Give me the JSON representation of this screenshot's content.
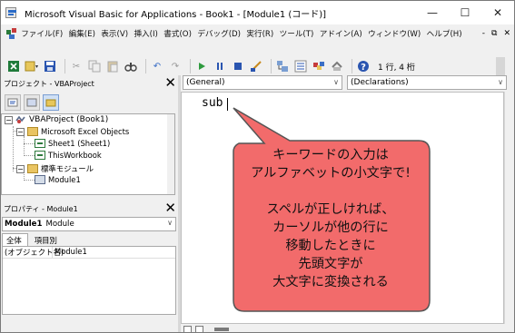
{
  "window": {
    "title": "Microsoft Visual Basic for Applications - Book1 - [Module1 (コード)]",
    "minimize": "—",
    "maximize": "☐",
    "close": "✕"
  },
  "menu": {
    "items": [
      "ファイル(F)",
      "編集(E)",
      "表示(V)",
      "挿入(I)",
      "書式(O)",
      "デバッグ(D)",
      "実行(R)",
      "ツール(T)",
      "アドイン(A)",
      "ウィンドウ(W)",
      "ヘルプ(H)"
    ],
    "mdi_minimize": "-",
    "mdi_restore": "⧉",
    "mdi_close": "✕"
  },
  "toolbar": {
    "icons": [
      "excel-icon",
      "insert-module-icon",
      "save-icon",
      "cut-icon",
      "copy-icon",
      "paste-icon",
      "find-icon",
      "undo-icon",
      "redo-icon",
      "run-icon",
      "break-icon",
      "reset-icon",
      "design-mode-icon",
      "project-explorer-icon",
      "properties-icon",
      "object-browser-icon",
      "toolbox-icon",
      "help-icon"
    ],
    "position": "1 行, 4 桁"
  },
  "project_pane": {
    "title": "プロジェクト - VBAProject",
    "tree": {
      "root": "VBAProject (Book1)",
      "excel_objects_folder": "Microsoft Excel Objects",
      "sheet1": "Sheet1 (Sheet1)",
      "thisworkbook": "ThisWorkbook",
      "modules_folder": "標準モジュール",
      "module1": "Module1"
    }
  },
  "properties_pane": {
    "title": "プロパティ - Module1",
    "object_name": "Module1",
    "object_type": "Module",
    "tabs": [
      "全体",
      "項目別"
    ],
    "rows": [
      {
        "key": "(オブジェクト名)",
        "value": "Module1"
      }
    ]
  },
  "code_window": {
    "object_combo": "(General)",
    "proc_combo": "(Declarations)",
    "code": "sub"
  },
  "callout": {
    "lines": [
      "キーワードの入力は",
      "アルファベットの小文字で!",
      "",
      "スペルが正しければ、",
      "カーソルが他の行に",
      "移動したときに",
      "先頭文字が",
      "大文字に変換される"
    ],
    "fill": "#f26b6b",
    "border": "#555555"
  }
}
